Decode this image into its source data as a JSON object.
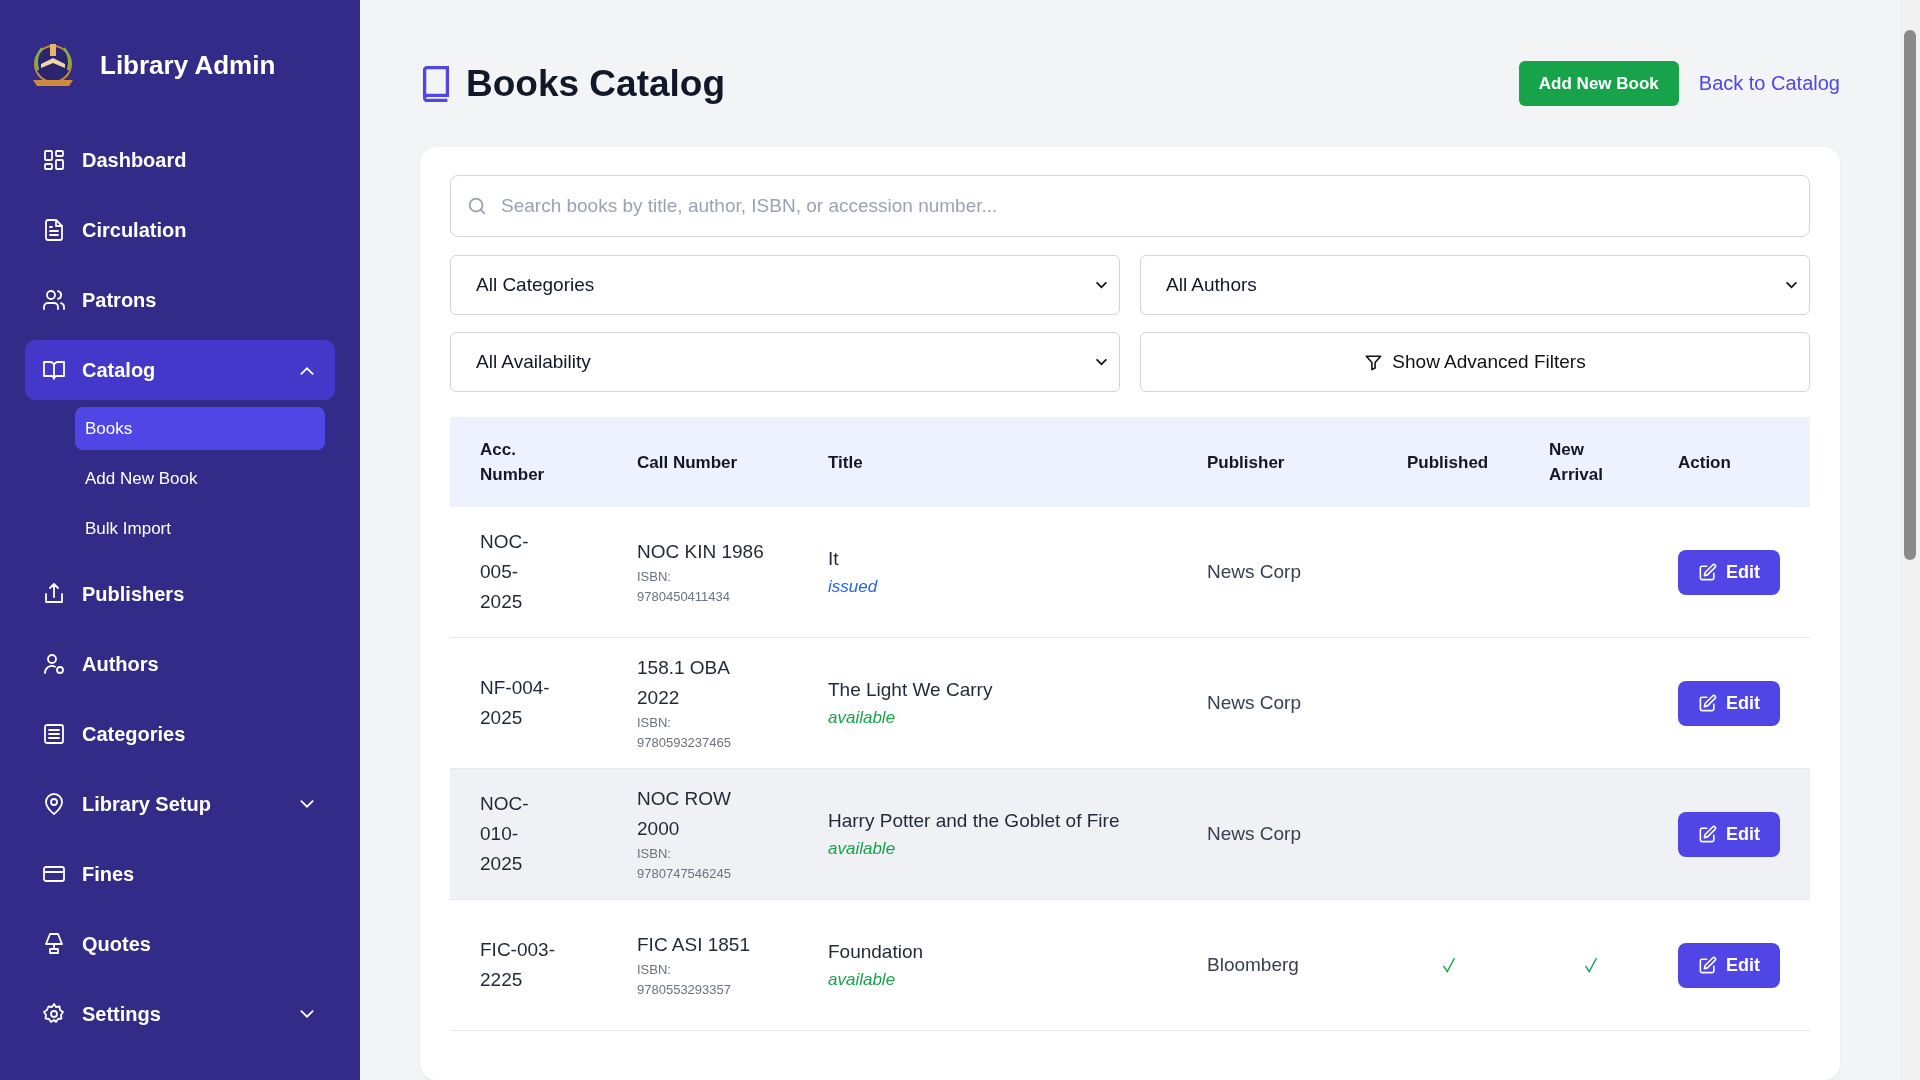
{
  "sidebar": {
    "brand": "Library Admin",
    "items": [
      {
        "label": "Dashboard",
        "selected": false
      },
      {
        "label": "Circulation",
        "selected": false
      },
      {
        "label": "Patrons",
        "selected": false
      },
      {
        "label": "Catalog",
        "selected": true,
        "expanded": true,
        "children": [
          {
            "label": "Books",
            "selected": true
          },
          {
            "label": "Add New Book",
            "selected": false
          },
          {
            "label": "Bulk Import",
            "selected": false
          }
        ]
      },
      {
        "label": "Publishers",
        "selected": false
      },
      {
        "label": "Authors",
        "selected": false
      },
      {
        "label": "Categories",
        "selected": false
      },
      {
        "label": "Library Setup",
        "selected": false,
        "expanded": false
      },
      {
        "label": "Fines",
        "selected": false
      },
      {
        "label": "Quotes",
        "selected": false
      },
      {
        "label": "Settings",
        "selected": false,
        "expanded": false
      }
    ]
  },
  "page": {
    "title": "Books Catalog",
    "add_button": "Add New Book",
    "back_link": "Back to Catalog"
  },
  "search": {
    "placeholder": "Search books by title, author, ISBN, or accession number..."
  },
  "filters": {
    "category": "All Categories",
    "author": "All Authors",
    "availability": "All Availability",
    "advanced_button": "Show Advanced Filters"
  },
  "table": {
    "columns": [
      "Acc. Number",
      "Call Number",
      "Title",
      "Publisher",
      "Published",
      "New Arrival",
      "Action"
    ],
    "rows": [
      {
        "acc_number": "NOC-005-2025",
        "call_number": "NOC KIN 1986",
        "isbn": "ISBN: 9780450411434",
        "title": "It",
        "status": {
          "text": "issued",
          "kind": "issued"
        },
        "publisher": "News Corp",
        "published": false,
        "new_arrival": false,
        "hovered": false,
        "action": "Edit"
      },
      {
        "acc_number": "NF-004-2025",
        "call_number": "158.1 OBA 2022",
        "isbn": "ISBN: 9780593237465",
        "title": "The Light We Carry",
        "status": {
          "text": "available",
          "kind": "available"
        },
        "publisher": "News Corp",
        "published": false,
        "new_arrival": false,
        "hovered": false,
        "action": "Edit"
      },
      {
        "acc_number": "NOC-010-2025",
        "call_number": "NOC ROW 2000",
        "isbn": "ISBN: 9780747546245",
        "title": "Harry Potter and the Goblet of Fire",
        "status": {
          "text": "available",
          "kind": "available"
        },
        "publisher": "News Corp",
        "published": false,
        "new_arrival": false,
        "hovered": true,
        "action": "Edit"
      },
      {
        "acc_number": "FIC-003-2225",
        "call_number": "FIC ASI 1851",
        "isbn": "ISBN: 9780553293357",
        "title": "Foundation",
        "status": {
          "text": "available",
          "kind": "available"
        },
        "publisher": "Bloomberg",
        "published": true,
        "new_arrival": true,
        "hovered": false,
        "action": "Edit"
      }
    ]
  }
}
